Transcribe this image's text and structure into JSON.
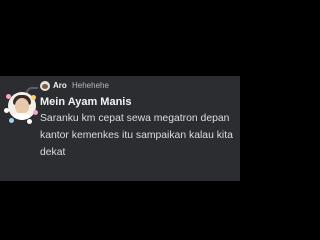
{
  "reply": {
    "author": "Aro",
    "text": "Hehehehe"
  },
  "message": {
    "author": "Mein Ayam Manis",
    "text": "Saranku km cepat sewa megatron depan kantor kemenkes itu sampaikan kalau kita dekat"
  },
  "colors": {
    "background": "#000000",
    "card": "#2b2d31",
    "username": "#f2f3f5",
    "message_text": "#dbdee1",
    "reply_text": "#b5bac1"
  }
}
